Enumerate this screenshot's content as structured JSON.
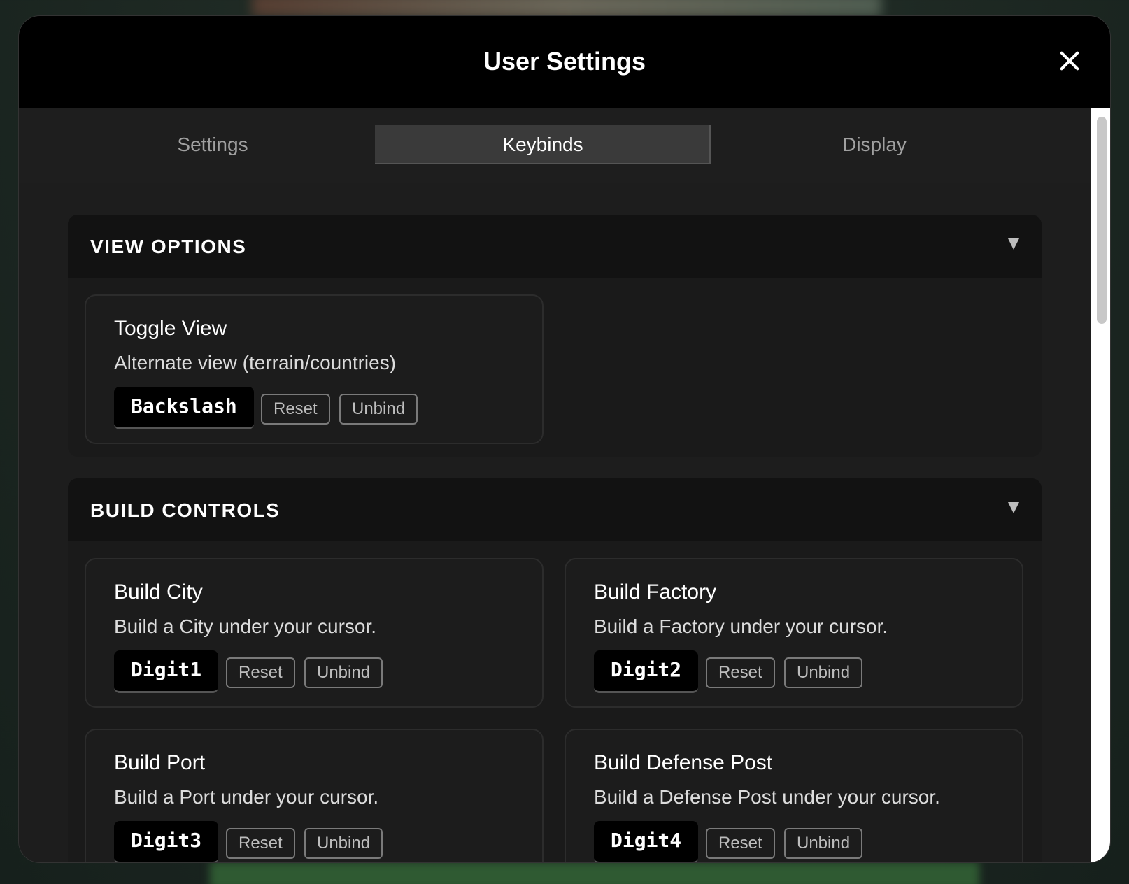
{
  "modal": {
    "title": "User Settings"
  },
  "tabs": [
    {
      "label": "Settings",
      "active": false
    },
    {
      "label": "Keybinds",
      "active": true
    },
    {
      "label": "Display",
      "active": false
    }
  ],
  "sections": {
    "view_options": {
      "title": "VIEW OPTIONS",
      "items": [
        {
          "title": "Toggle View",
          "description": "Alternate view (terrain/countries)",
          "key": "Backslash",
          "reset": "Reset",
          "unbind": "Unbind"
        }
      ]
    },
    "build_controls": {
      "title": "BUILD CONTROLS",
      "items": [
        {
          "title": "Build City",
          "description": "Build a City under your cursor.",
          "key": "Digit1",
          "reset": "Reset",
          "unbind": "Unbind"
        },
        {
          "title": "Build Factory",
          "description": "Build a Factory under your cursor.",
          "key": "Digit2",
          "reset": "Reset",
          "unbind": "Unbind"
        },
        {
          "title": "Build Port",
          "description": "Build a Port under your cursor.",
          "key": "Digit3",
          "reset": "Reset",
          "unbind": "Unbind"
        },
        {
          "title": "Build Defense Post",
          "description": "Build a Defense Post under your cursor.",
          "key": "Digit4",
          "reset": "Reset",
          "unbind": "Unbind"
        }
      ]
    }
  },
  "icons": {
    "close": "close-icon",
    "collapse": "chevron-down-icon"
  }
}
